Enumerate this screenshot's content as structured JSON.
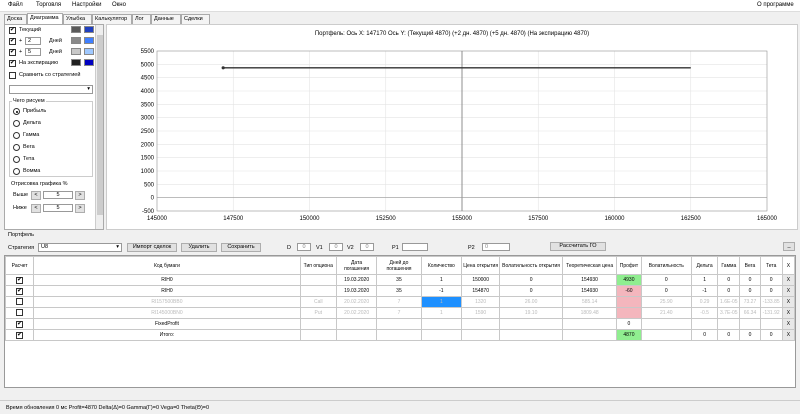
{
  "menu": {
    "items": [
      "Файл",
      "Торговля",
      "Настройки",
      "Окно"
    ],
    "about": "О программе"
  },
  "tabs": [
    "Доска",
    "Диаграмма",
    "Улыбка",
    "Калькулятор",
    "Лог",
    "Данные",
    "Сделки"
  ],
  "active_tab": "Диаграмма",
  "left": {
    "current_label": "Текущий",
    "plus_label": "+",
    "days_label": "Дней",
    "days1": "2",
    "days2": "5",
    "expiry_label": "На экспирацию",
    "compare_label": "Сравнить со стратегией",
    "draw_group": "Чего рисуем",
    "options": [
      "Прибыль",
      "Дельта",
      "Гамма",
      "Вега",
      "Тета",
      "Вомма"
    ],
    "selected": "Прибыль",
    "render_label": "Отрисовка графика %",
    "above_label": "Выше",
    "below_label": "Ниже",
    "above_value": "5",
    "below_value": "5",
    "colors": {
      "current": [
        "#5a5a5a",
        "#1f3fbf"
      ],
      "plus2": [
        "#8a8a8a",
        "#3f7fff"
      ],
      "plus5": [
        "#c8c8c8",
        "#9fc8ff"
      ],
      "expiry": [
        "#202020",
        "#0000c0"
      ]
    }
  },
  "chart_data": {
    "type": "line",
    "title": "Портфель: Ось X: 147170 Ось Y:  (Текущий 4870)  (+2 дн. 4870)  (+5 дн. 4870)  (На экспирацию 4870)",
    "xlim": [
      145000,
      165000
    ],
    "ylim": [
      -500,
      5500
    ],
    "xticks": [
      "145000",
      "147500",
      "150000",
      "152500",
      "155000",
      "157500",
      "160000",
      "162500",
      "165000"
    ],
    "yticks": [
      "5500",
      "5000",
      "4500",
      "4000",
      "3500",
      "3000",
      "2500",
      "2000",
      "1500",
      "1000",
      "500",
      "0",
      "-500"
    ],
    "cursor_x": 155000,
    "series": [
      {
        "x": [
          147170,
          162500
        ],
        "y": [
          4870,
          4870
        ],
        "color": "#333333"
      }
    ]
  },
  "portfolio": {
    "title": "Портфель",
    "strategy_label": "Стратегия",
    "strategy_value": "U8",
    "import_button": "Импорт сделок",
    "delete_button": "Удалить",
    "save_button": "Сохранить",
    "d_label": "D",
    "d_value": "0",
    "v1_label": "V1",
    "v1_value": "0",
    "v2_label": "V2",
    "v2_value": "0",
    "p1_label": "P1",
    "p1_value": "",
    "p2_label": "P2",
    "p2_value": "0",
    "calc_button": "Рассчитать ГО",
    "collapse_button": "_"
  },
  "table": {
    "headers": [
      "Расчет",
      "Код бумаги",
      "Тип опциона",
      "Дата погашения",
      "Дней до погашения",
      "Количество",
      "Цена открытия",
      "Волатильность открытия",
      "Теоретическая цена",
      "Профит",
      "Волатильность",
      "Дельта",
      "Гамма",
      "Вега",
      "Тета",
      "X"
    ],
    "rows": [
      {
        "check": "✔",
        "cells": [
          "RIH0",
          "",
          "19.03.2020",
          "35",
          "1",
          "150000",
          "0",
          "154930",
          "4930",
          "0",
          "1",
          "0",
          "0",
          "0",
          "X"
        ],
        "dim": false,
        "profit_class": "green"
      },
      {
        "check": "✔",
        "cells": [
          "RIH0",
          "",
          "19.03.2020",
          "35",
          "-1",
          "154870",
          "0",
          "154930",
          "-60",
          "0",
          "-1",
          "0",
          "0",
          "0",
          "X"
        ],
        "dim": false,
        "profit_class": "pink"
      },
      {
        "check": "",
        "cells": [
          "RI157500BB0",
          "Call",
          "20.02.2020",
          "7",
          "1",
          "1320",
          "26.00",
          "585.14",
          "",
          "25.90",
          "0.29",
          "1.6E-05",
          "73.27",
          "-133.85",
          "X"
        ],
        "dim": true,
        "profit_class": "pink",
        "qty_class": "blue"
      },
      {
        "check": "",
        "cells": [
          "RI145000BN0",
          "Put",
          "20.02.2020",
          "7",
          "1",
          "1590",
          "19.10",
          "1809.48",
          "",
          "21.40",
          "-0.5",
          "3.7E-05",
          "66.34",
          "-131.92",
          "X"
        ],
        "dim": true,
        "profit_class": "pink"
      },
      {
        "check": "✔",
        "cells": [
          "FixedProfit",
          "",
          "",
          "",
          "",
          "",
          "",
          "",
          "0",
          "",
          "",
          "",
          "",
          "",
          "X"
        ],
        "dim": false,
        "profit_class": ""
      },
      {
        "check": "✔",
        "cells": [
          "Итого:",
          "",
          "",
          "",
          "",
          "",
          "",
          "",
          "4870",
          "",
          "0",
          "0",
          "0",
          "0",
          "X"
        ],
        "dim": false,
        "profit_class": "green"
      }
    ]
  },
  "status": "Время обновления 0 мс   Profit=4870 Delta(Δ)=0 Gamma(Γ)=0 Vega=0 Theta(Θ)=0"
}
